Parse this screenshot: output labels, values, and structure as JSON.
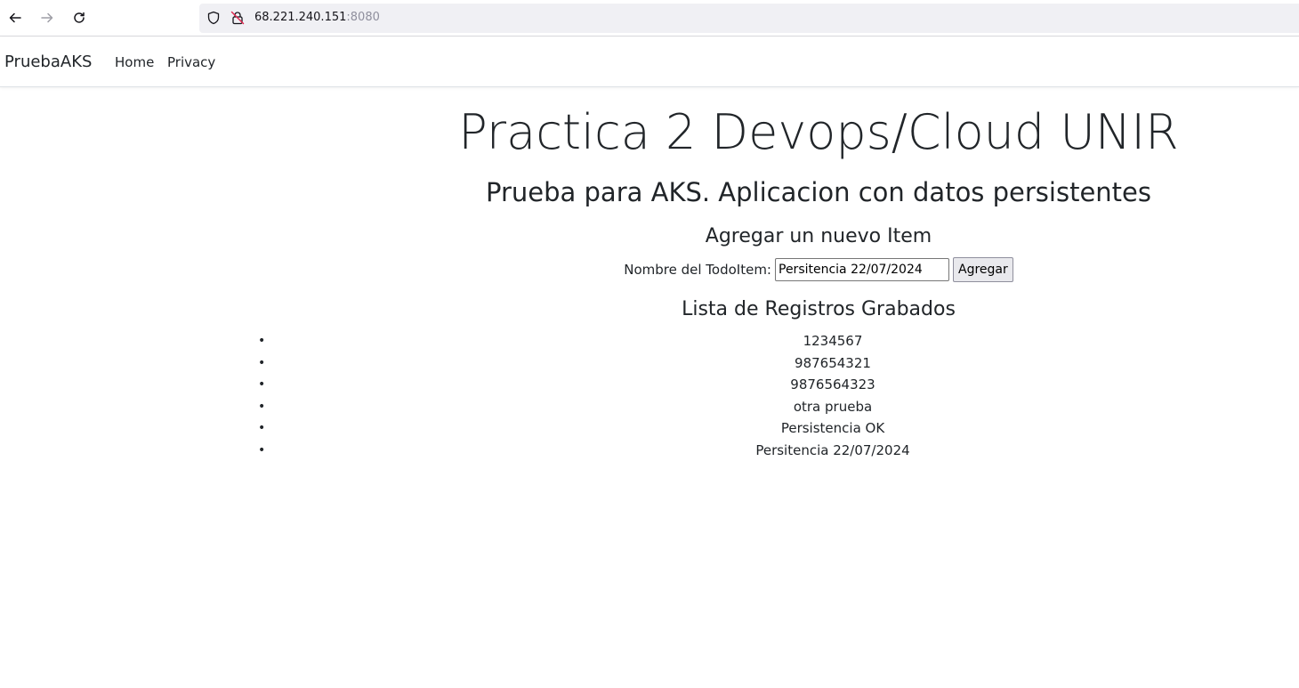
{
  "browser": {
    "url_host": "68.221.240.151",
    "url_port": ":8080",
    "icons": [
      "back-arrow-icon",
      "forward-arrow-icon",
      "reload-icon",
      "shield-icon",
      "insecure-lock-icon"
    ]
  },
  "navbar": {
    "brand": "PruebaAKS",
    "links": [
      "Home",
      "Privacy"
    ]
  },
  "main": {
    "title": "Practica 2 Devops/Cloud UNIR",
    "subtitle": "Prueba para AKS. Aplicacion con datos persistentes",
    "add_heading": "Agregar un nuevo Item",
    "form": {
      "label": "Nombre del TodoItem:",
      "input_value": "Persitencia 22/07/2024",
      "button_label": "Agregar"
    },
    "list_heading": "Lista de Registros Grabados",
    "records": [
      "1234567",
      "987654321",
      "9876564323",
      "otra prueba",
      "Persistencia OK",
      "Persitencia 22/07/2024"
    ]
  },
  "colors": {
    "text": "#212529",
    "url_bar_bg": "#f0f0f4",
    "button_bg": "#e9e9ed"
  }
}
